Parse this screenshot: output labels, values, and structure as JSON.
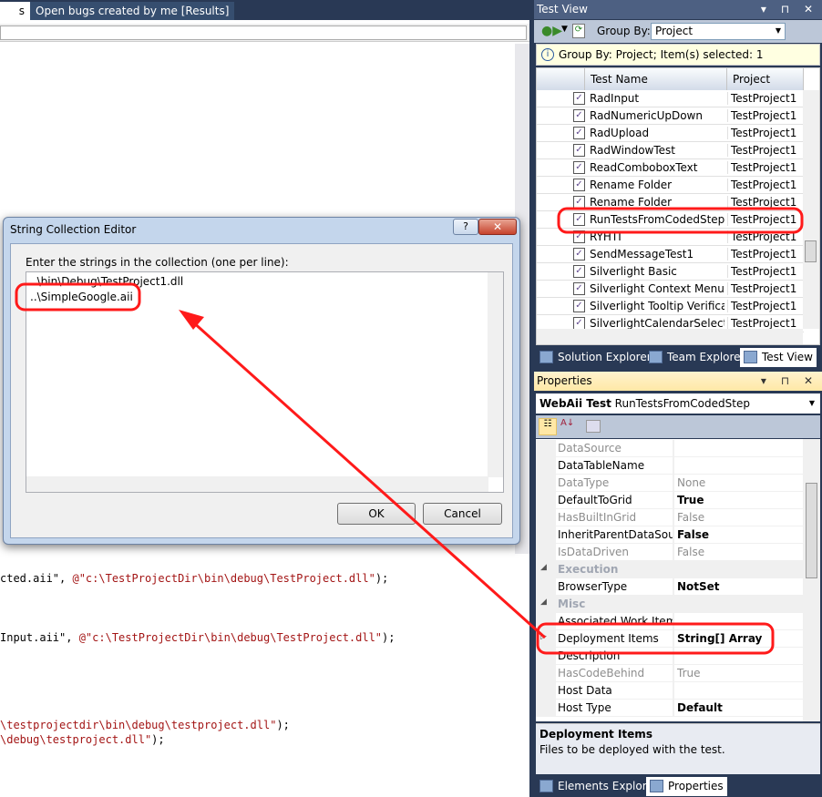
{
  "doc_tabs": [
    {
      "label": "s",
      "active": true
    },
    {
      "label": "Open bugs created by me [Results]",
      "active": false
    }
  ],
  "code_lines": [
    {
      "pre": "cted.aii\", ",
      "str": "@\"c:\\TestProjectDir\\bin\\debug\\TestProject.dll\"",
      "post": ");"
    },
    {
      "pre": "Input.aii\", ",
      "str": "@\"c:\\TestProjectDir\\bin\\debug\\TestProject.dll\"",
      "post": ");"
    },
    {
      "pre": "",
      "str": "\\testprojectdir\\bin\\debug\\testproject.dll\"",
      "post": ");"
    },
    {
      "pre": "",
      "str": "\\debug\\testproject.dll\"",
      "post": ");"
    }
  ],
  "dialog": {
    "title": "String Collection Editor",
    "help": "?",
    "close": "✕",
    "label": "Enter the strings in the collection (one per line):",
    "lines": [
      "..\\bin\\Debug\\TestProject1.dll",
      "..\\SimpleGoogle.aii"
    ],
    "ok": "OK",
    "cancel": "Cancel"
  },
  "test_view": {
    "title": "Test View",
    "controls": "▾ ⊓ ✕",
    "group_by_label": "Group By:",
    "group_by_value": "Project",
    "info": "Group By: Project; Item(s) selected: 1",
    "columns": [
      "Test Name",
      "Project"
    ],
    "rows": [
      {
        "name": "RadInput",
        "project": "TestProject1"
      },
      {
        "name": "RadNumericUpDown",
        "project": "TestProject1"
      },
      {
        "name": "RadUpload",
        "project": "TestProject1"
      },
      {
        "name": "RadWindowTest",
        "project": "TestProject1"
      },
      {
        "name": "ReadComboboxText",
        "project": "TestProject1"
      },
      {
        "name": "Rename Folder",
        "project": "TestProject1"
      },
      {
        "name": "Rename Folder",
        "project": "TestProject1"
      },
      {
        "name": "RunTestsFromCodedStep",
        "project": "TestProject1",
        "selected": true
      },
      {
        "name": "RYHTI",
        "project": "TestProject1"
      },
      {
        "name": "SendMessageTest1",
        "project": "TestProject1"
      },
      {
        "name": "Silverlight Basic",
        "project": "TestProject1"
      },
      {
        "name": "Silverlight Context Menu",
        "project": "TestProject1"
      },
      {
        "name": "Silverlight Tooltip Verification",
        "project": "TestProject1"
      },
      {
        "name": "SilverlightCalendarSelection",
        "project": "TestProject1"
      }
    ],
    "tabs": [
      "Solution Explorer",
      "Team Explorer",
      "Test View"
    ],
    "active_tab": "Test View"
  },
  "properties": {
    "title": "Properties",
    "controls": "▾ ⊓ ✕",
    "object_type": "WebAii Test",
    "object_name": "RunTestsFromCodedStep",
    "rows": [
      {
        "k": "DataSource",
        "v": "",
        "ro": true
      },
      {
        "k": "DataTableName",
        "v": ""
      },
      {
        "k": "DataType",
        "v": "None",
        "ro": true
      },
      {
        "k": "DefaultToGrid",
        "v": "True",
        "bold": true
      },
      {
        "k": "HasBuiltInGrid",
        "v": "False",
        "ro": true
      },
      {
        "k": "InheritParentDataSource",
        "v": "False",
        "bold": true
      },
      {
        "k": "IsDataDriven",
        "v": "False",
        "ro": true
      },
      {
        "k": "Execution",
        "cat": true
      },
      {
        "k": "BrowserType",
        "v": "NotSet",
        "bold": true
      },
      {
        "k": "Misc",
        "cat": true
      },
      {
        "k": "Associated Work Items",
        "v": ""
      },
      {
        "k": "Deployment Items",
        "v": "String[] Array",
        "bold": true,
        "expand": true
      },
      {
        "k": "Description",
        "v": ""
      },
      {
        "k": "HasCodeBehind",
        "v": "True",
        "ro": true
      },
      {
        "k": "Host Data",
        "v": ""
      },
      {
        "k": "Host Type",
        "v": "Default",
        "bold": true
      }
    ],
    "desc_title": "Deployment Items",
    "desc_text": "Files to be deployed with the test.",
    "tabs": [
      "Elements Explorer",
      "Properties"
    ],
    "active_tab": "Properties"
  },
  "colors": {
    "annotation": "#ff1a1a",
    "ide_background": "#293955",
    "string": "#a31515"
  }
}
